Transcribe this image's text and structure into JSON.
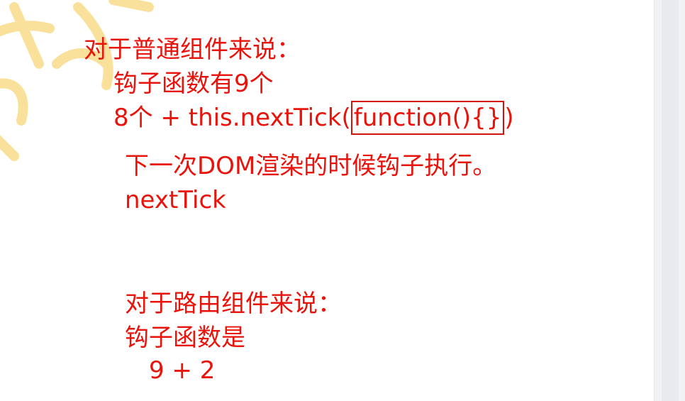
{
  "notes": {
    "line1": "对于普通组件来说：",
    "line2": "钩子函数有9个",
    "line3_prefix": "8个 + this.nextTick(",
    "line3_boxed": "function(){}",
    "line3_suffix": ")",
    "line4": "下一次DOM渲染的时候钩子执行。",
    "line5": "nextTick",
    "line6": "对于路由组件来说：",
    "line7": "钩子函数是",
    "line8": "9 + 2"
  },
  "colors": {
    "text": "#e8140c",
    "box_border": "#d4140c",
    "watermark": "#f7c94a"
  }
}
